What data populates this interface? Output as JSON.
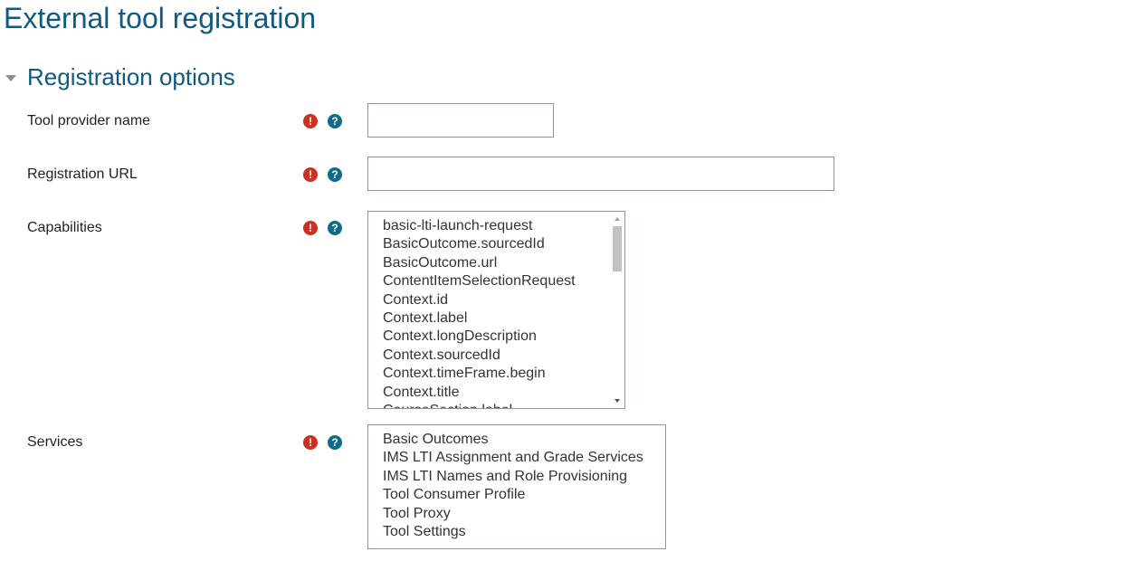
{
  "page_title": "External tool registration",
  "section": {
    "title": "Registration options",
    "expanded": true
  },
  "icons": {
    "required": "exclamation-circle-icon",
    "help": "question-circle-icon",
    "required_color": "#ca3120",
    "help_color": "#0f6b8a"
  },
  "fields": {
    "tool_provider_name": {
      "label": "Tool provider name",
      "value": ""
    },
    "registration_url": {
      "label": "Registration URL",
      "value": ""
    },
    "capabilities": {
      "label": "Capabilities",
      "options": [
        "basic-lti-launch-request",
        "BasicOutcome.sourcedId",
        "BasicOutcome.url",
        "ContentItemSelectionRequest",
        "Context.id",
        "Context.label",
        "Context.longDescription",
        "Context.sourcedId",
        "Context.timeFrame.begin",
        "Context.title",
        "CourseSection.label"
      ]
    },
    "services": {
      "label": "Services",
      "options": [
        "Basic Outcomes",
        "IMS LTI Assignment and Grade Services",
        "IMS LTI Names and Role Provisioning",
        "Tool Consumer Profile",
        "Tool Proxy",
        "Tool Settings"
      ]
    }
  }
}
